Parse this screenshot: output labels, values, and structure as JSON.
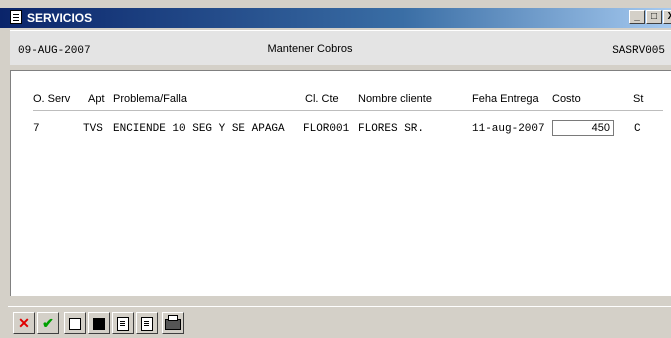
{
  "window": {
    "title": "SERVICIOS",
    "min_label": "_",
    "max_label": "□",
    "close_label": "X"
  },
  "header": {
    "date": "09-AUG-2007",
    "title": "Mantener Cobros",
    "code": "SASRV005"
  },
  "table": {
    "columns": [
      "O. Serv",
      "Apt",
      "Problema/Falla",
      "Cl. Cte",
      "Nombre cliente",
      "Feha Entrega",
      "Costo",
      "St"
    ],
    "rows": [
      {
        "o_serv": "7",
        "apt": "TVS",
        "problema": "ENCIENDE 10 SEG Y SE APAGA",
        "cl_cte": "FLOR001",
        "nombre": "FLORES SR.",
        "entrega": "11-aug-2007",
        "costo": "450",
        "st": "C"
      }
    ]
  },
  "toolbar": {
    "cancel_label": "✕",
    "accept_label": "✔",
    "icons": [
      "cancel-icon",
      "check-icon",
      "window-icon",
      "maximize-icon",
      "page-prev-icon",
      "page-next-icon",
      "print-icon"
    ]
  },
  "colors": {
    "title_start": "#0a246a",
    "title_end": "#a6caf0",
    "cancel": "#e00000",
    "accept": "#00a000"
  }
}
